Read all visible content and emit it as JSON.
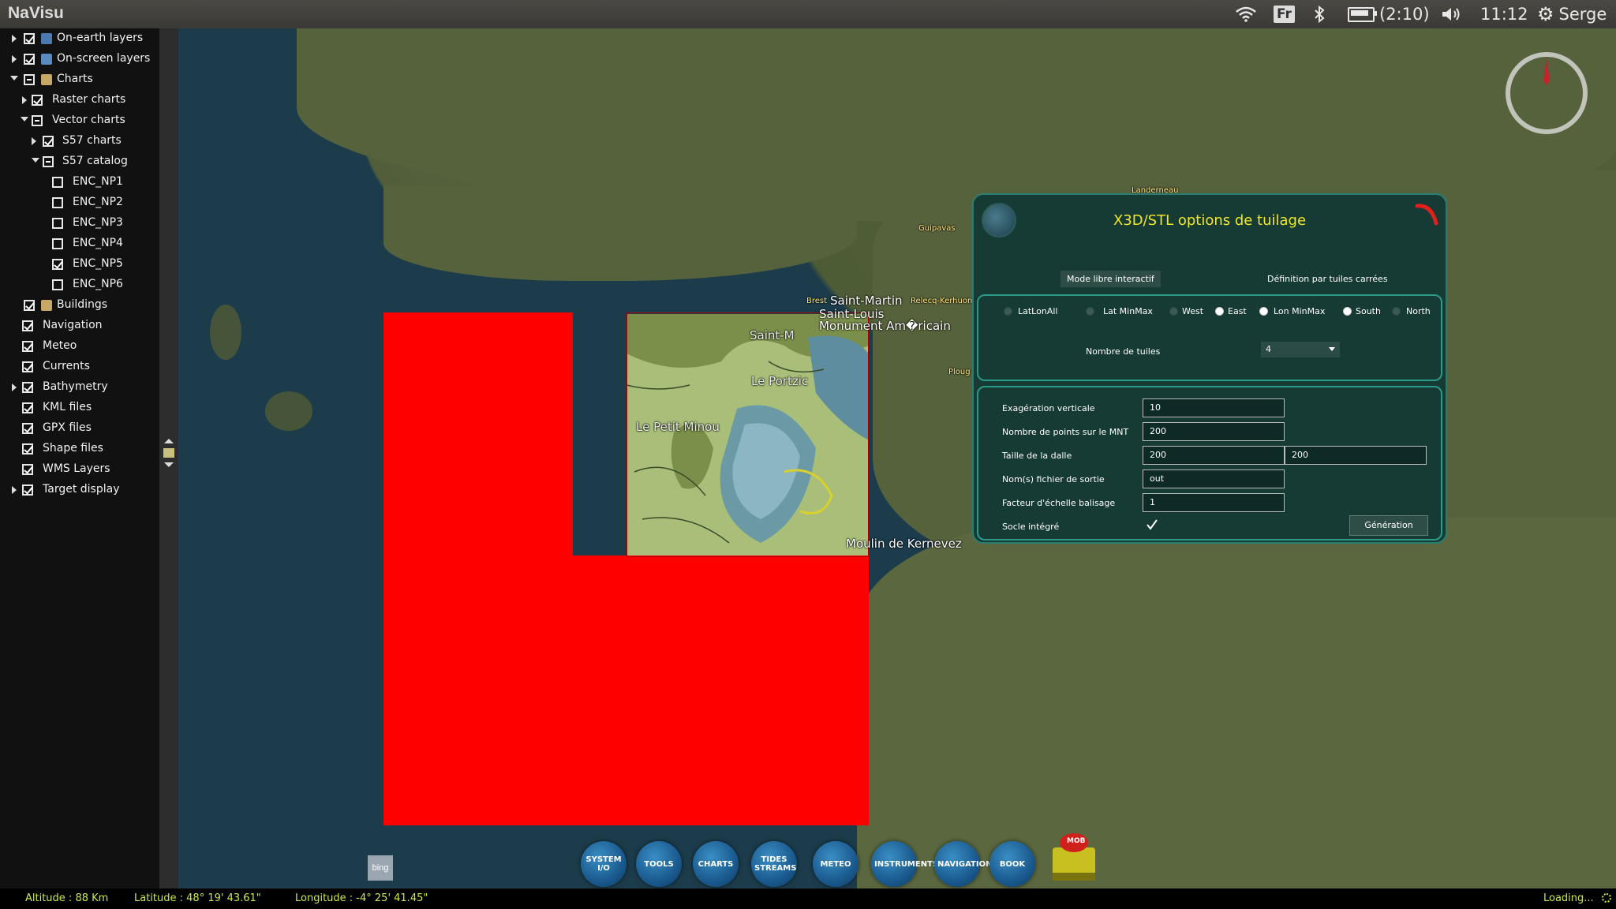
{
  "app": {
    "title": "NaVisu"
  },
  "tray": {
    "lang": "Fr",
    "battery": "(2:10)",
    "time": "11:12",
    "user": "Serge"
  },
  "tree": [
    {
      "label": "On-earth layers",
      "checked": true
    },
    {
      "label": "On-screen layers",
      "checked": true
    },
    {
      "label": "Charts",
      "checked": "partial"
    },
    {
      "label": "Raster charts",
      "checked": true
    },
    {
      "label": "Vector charts",
      "checked": "partial"
    },
    {
      "label": "S57 charts",
      "checked": true
    },
    {
      "label": "S57 catalog",
      "checked": "partial"
    },
    {
      "label": "ENC_NP1",
      "checked": false
    },
    {
      "label": "ENC_NP2",
      "checked": false
    },
    {
      "label": "ENC_NP3",
      "checked": false
    },
    {
      "label": "ENC_NP4",
      "checked": false
    },
    {
      "label": "ENC_NP5",
      "checked": true
    },
    {
      "label": "ENC_NP6",
      "checked": false
    },
    {
      "label": "Buildings",
      "checked": true
    },
    {
      "label": "Navigation",
      "checked": true
    },
    {
      "label": "Meteo",
      "checked": true
    },
    {
      "label": "Currents",
      "checked": true
    },
    {
      "label": "Bathymetry",
      "checked": true
    },
    {
      "label": "KML files",
      "checked": true
    },
    {
      "label": "GPX files",
      "checked": true
    },
    {
      "label": "Shape files",
      "checked": true
    },
    {
      "label": "WMS Layers",
      "checked": true
    },
    {
      "label": "Target display",
      "checked": true
    }
  ],
  "map_labels": {
    "saint_martin": "Saint-Martin",
    "saint_louis": "Saint-Louis",
    "monument": "Monument Am�ricain",
    "saint_m": "Saint-M",
    "le_portzic": "Le Portzic",
    "le_petit_minou": "Le Petit Minou",
    "moulin": "Moulin de Kernevez",
    "guipavas": "Guipavas",
    "relecq": "Relecq-Kerhuon",
    "plougastel": "Ploug",
    "landerneau": "Landerneau",
    "brest": "Brest"
  },
  "dialog": {
    "title": "X3D/STL options de tuilage",
    "tab_free": "Mode libre interactif",
    "tab_square": "Définition par tuiles carrées",
    "radios": [
      {
        "label": "LatLonAll",
        "selected": false
      },
      {
        "label": "Lat MinMax",
        "selected": false
      },
      {
        "label": "West",
        "selected": false
      },
      {
        "label": "East",
        "selected": true
      },
      {
        "label": "Lon MinMax",
        "selected": true
      },
      {
        "label": "South",
        "selected": true
      },
      {
        "label": "North",
        "selected": false
      }
    ],
    "tiles_label": "Nombre de tuiles",
    "tiles_value": "4",
    "fields": {
      "vert_exag_label": "Exagération verticale",
      "vert_exag_value": "10",
      "points_label": "Nombre de points sur le MNT",
      "points_value": "200",
      "slab_label": "Taille de la dalle",
      "slab_w": "200",
      "slab_h": "200",
      "outfile_label": "Nom(s) fichier de sortie",
      "outfile_value": "out",
      "scale_label": "Facteur d'échelle balisage",
      "scale_value": "1",
      "socle_label": "Socle intégré"
    },
    "generate": "Génération"
  },
  "toolbar": [
    {
      "label": "SYSTEM I/O"
    },
    {
      "label": "TOOLS"
    },
    {
      "label": "CHARTS"
    },
    {
      "label": "TIDES STREAMS"
    },
    {
      "label": "METEO"
    },
    {
      "label": "INSTRUMENTS"
    },
    {
      "label": "NAVIGATION"
    },
    {
      "label": "BOOK"
    }
  ],
  "mob": "MOB",
  "bing": "bing",
  "status": {
    "altitude": "Altitude : 88 Km",
    "latitude": "Latitude :   48° 19' 43.61\"",
    "longitude": "Longitude :  -4° 25' 41.45\"",
    "loading": "Loading..."
  }
}
